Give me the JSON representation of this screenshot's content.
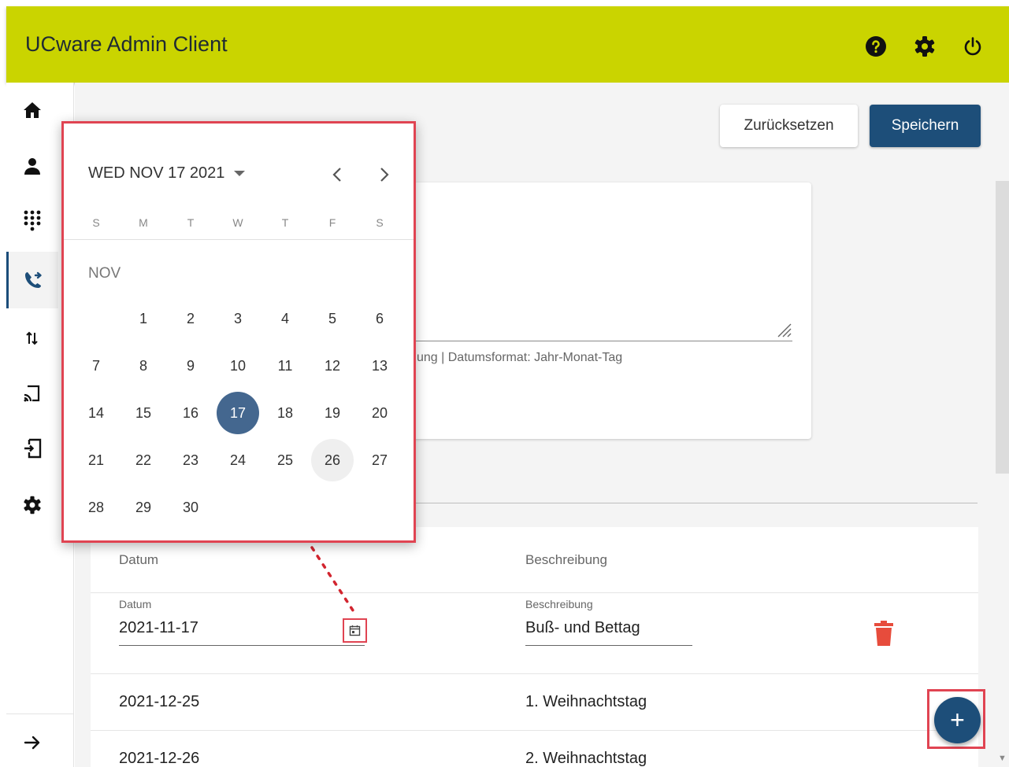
{
  "app": {
    "title": "UCware Admin Client"
  },
  "header": {
    "icons": [
      "help-icon",
      "gear-icon",
      "power-icon"
    ]
  },
  "sidebar": {
    "items": [
      {
        "name": "home-icon"
      },
      {
        "name": "user-icon"
      },
      {
        "name": "dialpad-icon"
      },
      {
        "name": "call-forward-icon",
        "active": true
      },
      {
        "name": "transfer-icon"
      },
      {
        "name": "cast-icon"
      },
      {
        "name": "login-icon"
      },
      {
        "name": "gear-icon"
      }
    ],
    "collapse_icon": "arrow-right-icon"
  },
  "actions": {
    "reset_label": "Zurücksetzen",
    "save_label": "Speichern"
  },
  "form": {
    "hint": "ung | Datumsformat: Jahr-Monat-Tag"
  },
  "datepicker": {
    "header": "WED NOV 17 2021",
    "weekdays": [
      "S",
      "M",
      "T",
      "W",
      "T",
      "F",
      "S"
    ],
    "month_label": "NOV",
    "selected_day": 17,
    "hovered_day": 26,
    "first_weekday_index": 1,
    "days_in_month": 30
  },
  "table": {
    "header": {
      "date": "Datum",
      "description": "Beschreibung"
    },
    "edit_row": {
      "date_label": "Datum",
      "date_value": "2021-11-17",
      "description_label": "Beschreibung",
      "description_value": "Buß- und Bettag"
    },
    "rows": [
      {
        "date": "2021-12-25",
        "description": "1. Weihnachtstag"
      },
      {
        "date": "2021-12-26",
        "description": "2. Weihnachtstag"
      }
    ]
  },
  "fab": {
    "label": "+"
  },
  "colors": {
    "topbar": "#cad400",
    "primary": "#1d4e79",
    "highlight": "#e04452",
    "delete": "#e74c3c"
  }
}
